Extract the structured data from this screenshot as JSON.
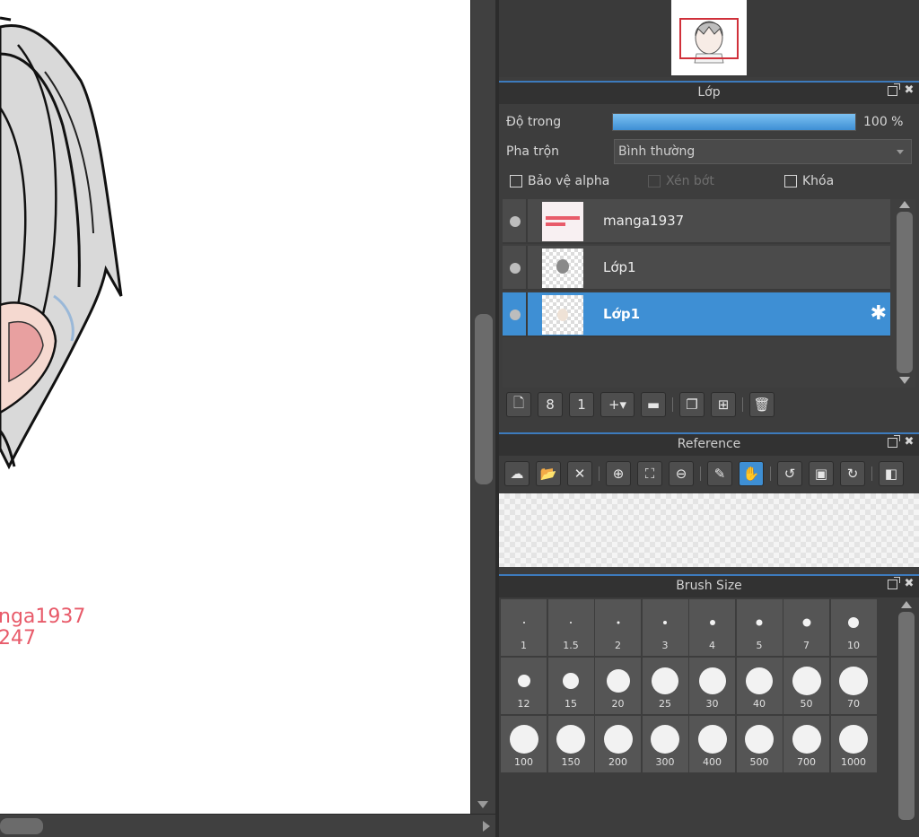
{
  "canvas": {
    "watermark_line1": "nga1937",
    "watermark_line2": "247"
  },
  "layer_panel": {
    "title": "Lớp",
    "opacity_label": "Độ trong",
    "opacity_value": "100 %",
    "opacity_fraction": 1.0,
    "blend_label": "Pha trộn",
    "blend_value": "Bình thường",
    "protect_alpha": "Bảo vệ alpha",
    "clipping": "Xén bớt",
    "lock": "Khóa",
    "layers": [
      {
        "name": "manga1937",
        "selected": false
      },
      {
        "name": "Lớp1",
        "selected": false
      },
      {
        "name": "Lớp1",
        "selected": true
      }
    ]
  },
  "reference_panel": {
    "title": "Reference"
  },
  "brush_panel": {
    "title": "Brush Size",
    "sizes": [
      "1",
      "1.5",
      "2",
      "3",
      "4",
      "5",
      "7",
      "10",
      "12",
      "15",
      "20",
      "25",
      "30",
      "40",
      "50",
      "70",
      "100",
      "150",
      "200",
      "300",
      "400",
      "500",
      "700",
      "1000"
    ]
  },
  "icons": {
    "panel_title_icons": [
      "popout-icon",
      "close-icon"
    ],
    "layer_toolbar": [
      "new-layer-icon",
      "new-8bit-layer-icon",
      "new-1bit-layer-icon",
      "add-layer-menu-icon",
      "new-folder-icon",
      "duplicate-layer-icon",
      "merge-layer-icon",
      "delete-layer-icon"
    ],
    "reference_toolbar": [
      "cloud-upload-icon",
      "open-folder-icon",
      "close-icon",
      "zoom-in-icon",
      "fit-icon",
      "zoom-out-icon",
      "eyedropper-icon",
      "hand-icon",
      "rotate-left-icon",
      "actual-size-icon",
      "rotate-right-icon",
      "flip-icon"
    ]
  },
  "colors": {
    "accent": "#3e8fd4",
    "panel_bg": "#3d3d3d",
    "watermark": "#e85b6a"
  }
}
